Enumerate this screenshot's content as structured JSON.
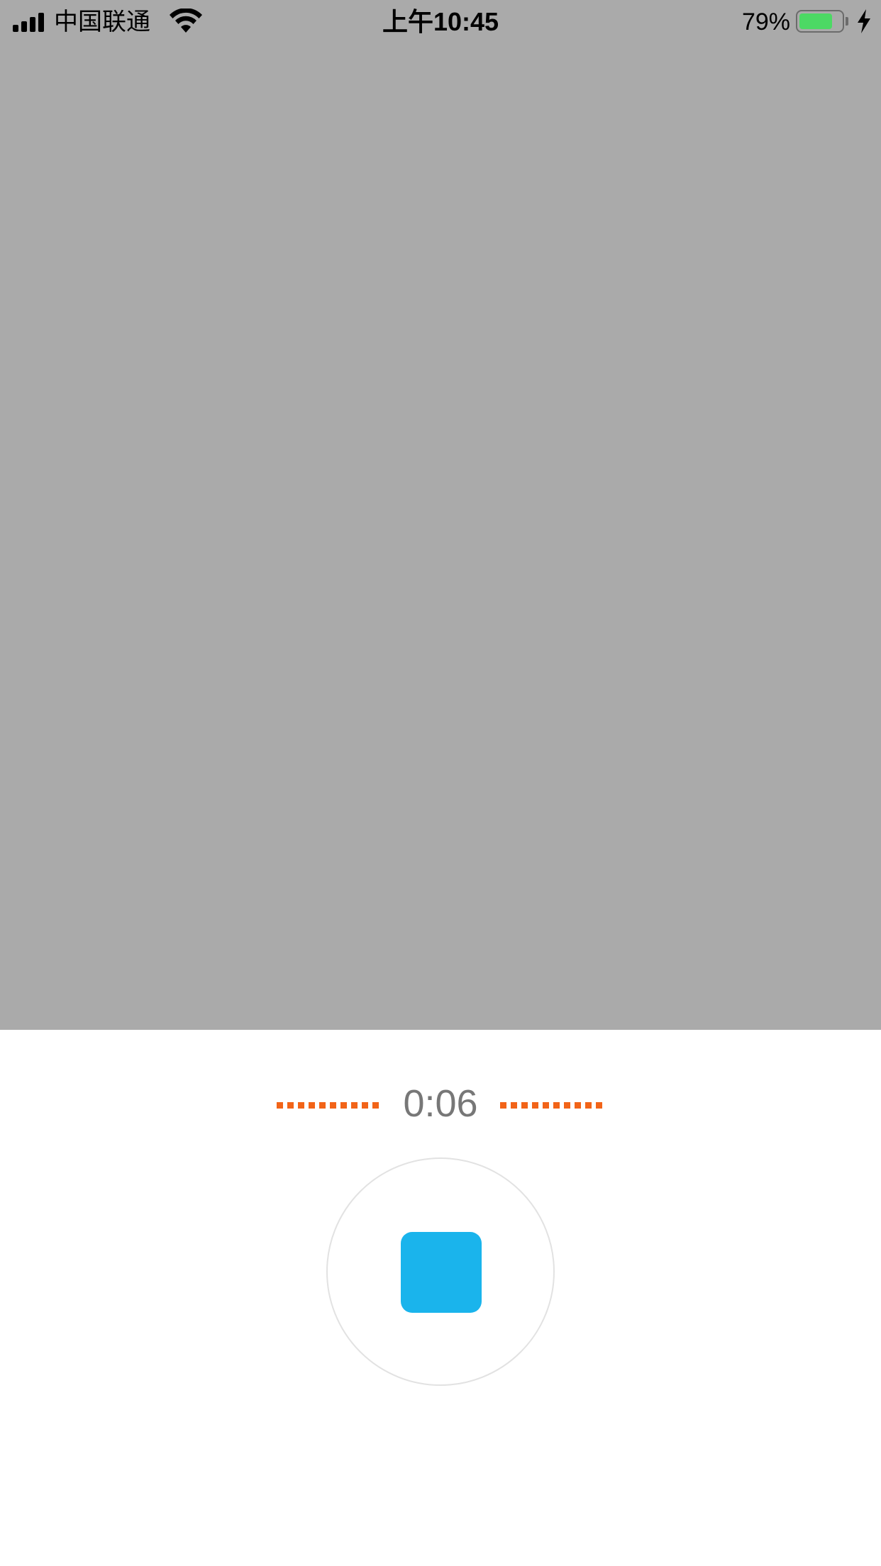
{
  "status_bar": {
    "carrier": "中国联通",
    "time": "上午10:45",
    "battery_percent": "79%",
    "battery_level": 0.79,
    "battery_color": "#4cd964",
    "signal_bars": 4,
    "icons": [
      "signal-icon",
      "wifi-icon",
      "battery-icon",
      "charging-bolt-icon"
    ]
  },
  "recorder": {
    "elapsed_time": "0:06",
    "level_indicator_color": "#f26418",
    "stop_button_color": "#1ab4ec",
    "stop_icon": "stop-square-icon"
  },
  "colors": {
    "top_background": "#aaaaaa",
    "bottom_background": "#ffffff",
    "timer_text": "#777777"
  }
}
